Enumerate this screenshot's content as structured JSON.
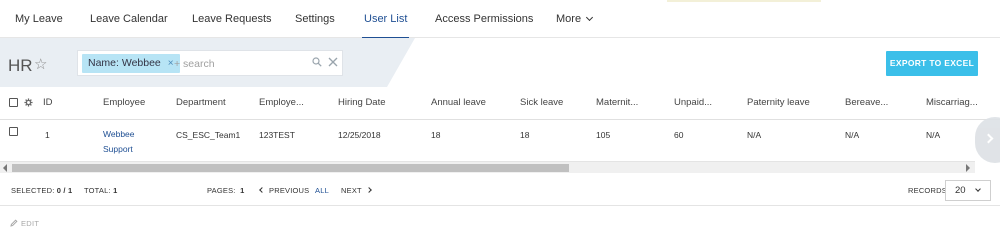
{
  "nav": {
    "items": [
      {
        "label": "My Leave"
      },
      {
        "label": "Leave Calendar"
      },
      {
        "label": "Leave Requests"
      },
      {
        "label": "Settings"
      },
      {
        "label": "User List",
        "active": true
      },
      {
        "label": "Access Permissions"
      },
      {
        "label": "More"
      }
    ]
  },
  "header": {
    "title": "HR",
    "search_chip": "Name: Webbee",
    "search_placeholder": "+ search",
    "export_label": "EXPORT TO EXCEL"
  },
  "table": {
    "columns": [
      "ID",
      "Employee",
      "Department",
      "Employe...",
      "Hiring Date",
      "Annual leave",
      "Sick leave",
      "Maternit...",
      "Unpaid...",
      "Paternity leave",
      "Bereave...",
      "Miscarriag..."
    ],
    "rows": [
      {
        "id": "1",
        "employee_line1": "Webbee",
        "employee_line2": "Support",
        "department": "CS_ESC_Team1",
        "employee_code": "123TEST",
        "hiring_date": "12/25/2018",
        "annual_leave": "18",
        "sick_leave": "18",
        "maternity": "105",
        "unpaid": "60",
        "paternity": "N/A",
        "bereavement": "N/A",
        "miscarriage": "N/A"
      }
    ]
  },
  "footer": {
    "selected_label": "SELECTED:",
    "selected_value": "0 / 1",
    "total_label": "TOTAL:",
    "total_value": "1",
    "pages_label": "PAGES:",
    "pages_value": "1",
    "previous": "PREVIOUS",
    "all": "ALL",
    "next": "NEXT",
    "records_label": "RECORDS:",
    "records_value": "20"
  },
  "edit_label": "EDIT",
  "colors": {
    "accent_blue": "#1f4f93",
    "export_button": "#3bbfe9",
    "search_chip": "#b7e4f5",
    "band": "#e9eef3"
  }
}
